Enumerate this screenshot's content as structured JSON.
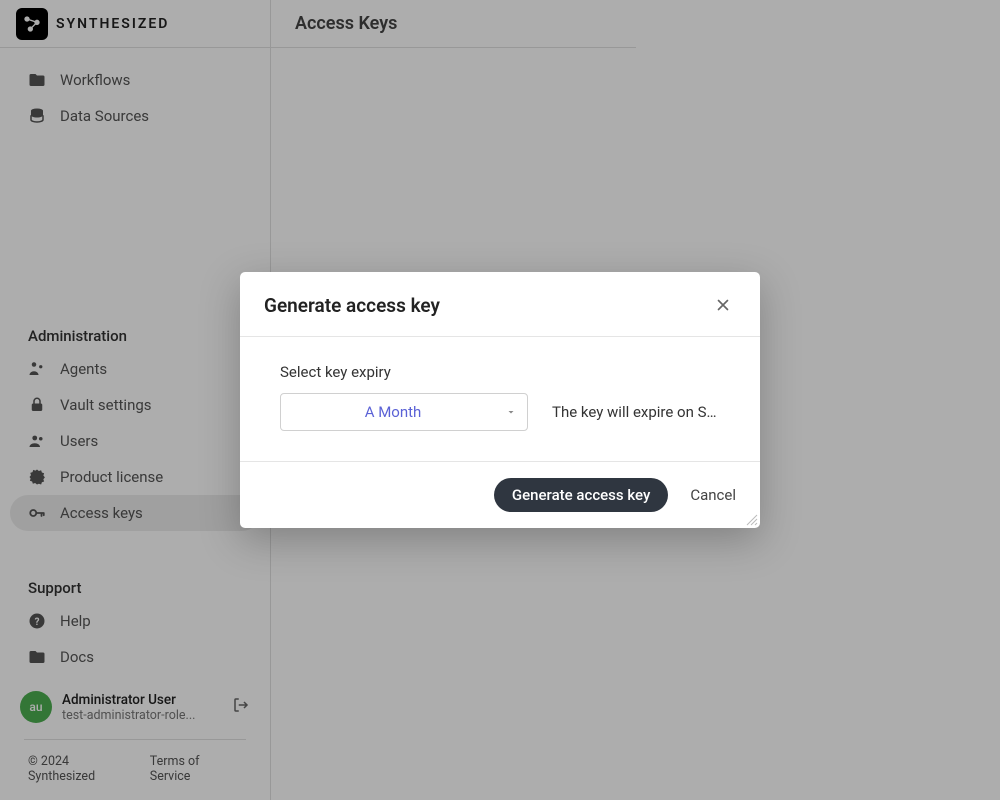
{
  "brand": {
    "name": "SYNTHESIZED"
  },
  "sidebar": {
    "top": [
      {
        "icon": "folder",
        "label": "Workflows"
      },
      {
        "icon": "database",
        "label": "Data Sources"
      }
    ],
    "admin_label": "Administration",
    "admin": [
      {
        "icon": "agents",
        "label": "Agents"
      },
      {
        "icon": "lock",
        "label": "Vault settings"
      },
      {
        "icon": "users",
        "label": "Users"
      },
      {
        "icon": "badge",
        "label": "Product license"
      },
      {
        "icon": "key",
        "label": "Access keys",
        "active": true
      }
    ],
    "support_label": "Support",
    "support": [
      {
        "icon": "help",
        "label": "Help"
      },
      {
        "icon": "folder",
        "label": "Docs"
      }
    ]
  },
  "user": {
    "avatar_initials": "au",
    "name": "Administrator User",
    "email": "test-administrator-role..."
  },
  "footer": {
    "copyright": "© 2024 Synthesized",
    "tos": "Terms of Service"
  },
  "page": {
    "title": "Access Keys"
  },
  "dialog": {
    "title": "Generate access key",
    "field_label": "Select key expiry",
    "select_value": "A Month",
    "hint": "The key will expire on Sat...",
    "primary_btn": "Generate access key",
    "cancel_btn": "Cancel"
  }
}
